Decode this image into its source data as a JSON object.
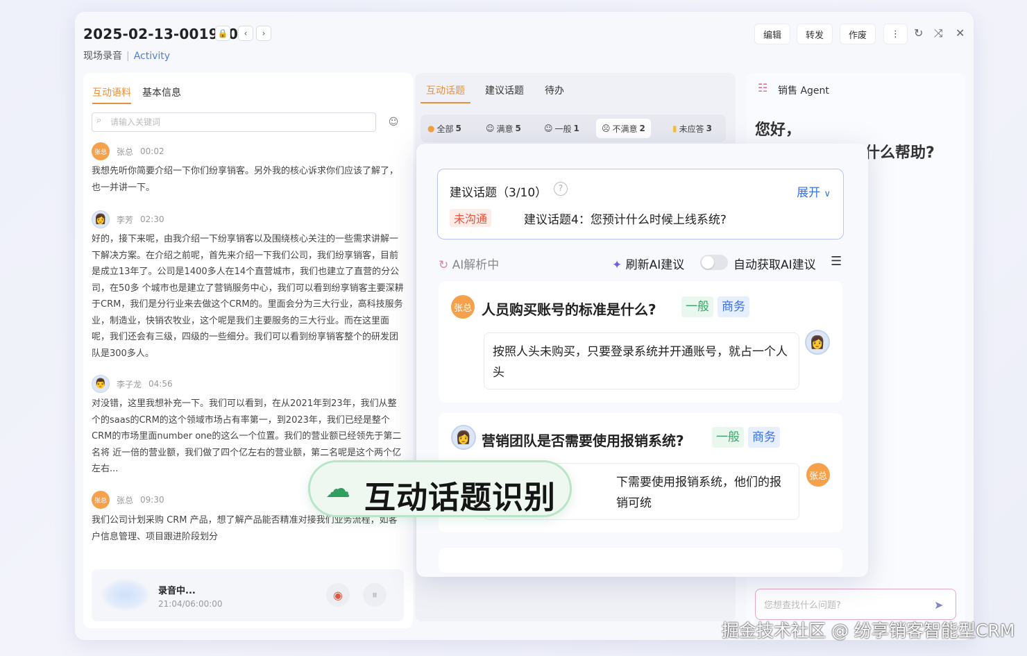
{
  "header": {
    "record_id": "2025-02-13-001960",
    "lock_icon": "lock-icon",
    "subtitle": "现场录音",
    "subtitle_link": "Activity",
    "actions": {
      "edit": "编辑",
      "forward": "转发",
      "void": "作废"
    }
  },
  "left": {
    "tabs": [
      "互动语料",
      "基本信息"
    ],
    "search_placeholder": "请输入关键词",
    "messages": [
      {
        "avatar_text": "张总",
        "speaker": "张总",
        "time": "00:02",
        "text": "我想先听你简要介绍一下你们纷享销客。另外我的核心诉求你们应该了解了，也一并讲一下。"
      },
      {
        "avatar_text": "",
        "speaker": "李芳",
        "time": "02:30",
        "text": "好的，接下来呢，由我介绍一下纷享销客以及围绕核心关注的一些需求讲解一下解决方案。在介绍之前呢，首先来介绍一下我们公司，我们纷享销客，目前是成立13年了。公司是1400多人在14个直营城市，我们也建立了直营的分公司，在50多 个城市也是建立了营销服务中心，我们可以看到纷享销客主要深耕于CRM，我们是分行业来去做这个CRM的。里面会分为三大行业，高科技服务业，制造业，快销农牧业，这个呢是我们主要服务的三大行业。而在这里面呢，我们还会有三级，四级的一些细分。我们可以看到纷享销客整个的研发团队是300多人。"
      },
      {
        "avatar_text": "",
        "speaker": "李子龙",
        "time": "04:56",
        "text": "对没错，这里我想补充一下。我们可以看到，在从2021年到23年，我们从整个的saas的CRM的这个领域市场占有率第一，到2023年，我们已经是整个CRM的市场里面number one的这么一个位置。我们的营业额已经领先于第二名将 近一倍的营业额，我们做了四个亿左右的营业额，第二名呢是这个两个亿左右..."
      },
      {
        "avatar_text": "张总",
        "speaker": "张总",
        "time": "09:30",
        "text": "我们公司计划采购 CRM 产品，想了解产品能否精准对接我们业务流程，如客户信息管理、项目跟进阶段划分"
      }
    ],
    "recording": {
      "title": "录音中...",
      "time": "21:04/06:00:00"
    }
  },
  "middle": {
    "tabs": [
      "互动话题",
      "建议话题",
      "待办"
    ],
    "filters": [
      {
        "label": "全部",
        "count": "5"
      },
      {
        "label": "满意",
        "count": "5"
      },
      {
        "label": "一般",
        "count": "1"
      },
      {
        "label": "不满意",
        "count": "2"
      },
      {
        "label": "未应答",
        "count": "3"
      }
    ]
  },
  "popup": {
    "suggest": {
      "title": "建议话题（3/10）",
      "expand": "展开",
      "badge": "未沟通",
      "text": "建议话题4：您预计什么时候上线系统?"
    },
    "ai": {
      "status": "AI解析中",
      "refresh": "刷新AI建议",
      "auto": "自动获取AI建议",
      "auto_enabled": false
    },
    "topics": [
      {
        "asker_avatar": "张总",
        "question": "人员购买账号的标准是什么?",
        "tags": [
          "一般",
          "商务"
        ],
        "answer": "按照人头未购买，只要登录系统并开通账号，就占一个人头"
      },
      {
        "asker_avatar": "",
        "question": "营销团队是否需要使用报销系统?",
        "tags": [
          "一般",
          "商务"
        ],
        "answer": "下需要使用报销系统，他们的报销可统",
        "answer_avatar": "张总"
      }
    ]
  },
  "right": {
    "agent_title": "销售 Agent",
    "greeting": "您好，",
    "greeting2": "什么帮助?",
    "input_placeholder": "您想查找什么问题?"
  },
  "banner": {
    "text": "互动话题识别"
  },
  "watermark": "掘金技术社区 @ 纷享销客智能型CRM",
  "colors": {
    "accent_orange": "#e8903b",
    "accent_blue": "#3b6fe0",
    "tag_green": "#3aa56a",
    "badge_red": "#e5553a"
  }
}
